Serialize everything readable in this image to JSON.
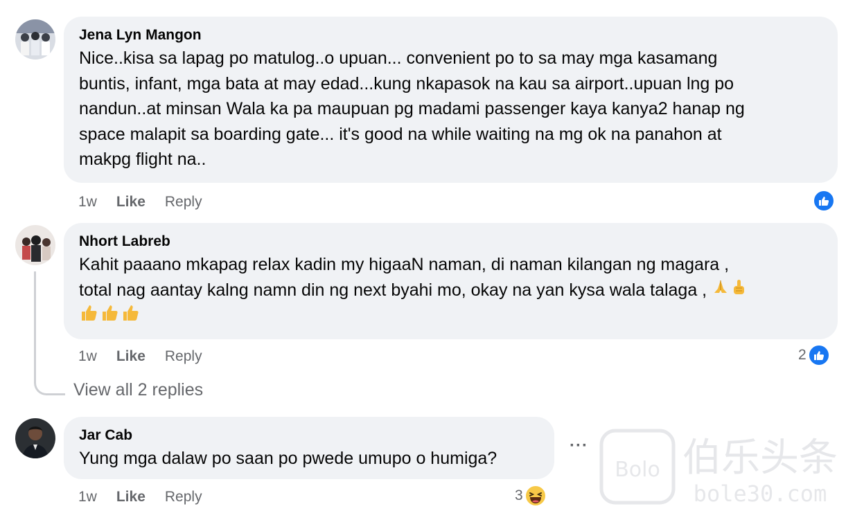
{
  "comments": [
    {
      "author": "Jena Lyn Mangon",
      "lines": [
        "Nice..kisa sa lapag po matulog..o upuan... convenient po to sa may mga kasamang",
        "buntis, infant, mga bata at may edad...kung nkapasok na kau sa airport..upuan lng po",
        "nandun..at minsan Wala ka pa maupuan pg madami passenger kaya kanya2 hanap ng",
        "space malapit sa boarding gate... it's good na while waiting na mg ok na panahon at",
        "makpg flight na.."
      ],
      "time": "1w",
      "like_label": "Like",
      "reply_label": "Reply",
      "reaction_count": ""
    },
    {
      "author": "Nhort Labreb",
      "lines": [
        "Kahit paaano mkapag relax kadin my higaaN naman, di naman kilangan ng magara ,",
        "total nag aantay kalng namn din ng next byahi mo, okay na yan kysa wala talaga ,"
      ],
      "time": "1w",
      "like_label": "Like",
      "reply_label": "Reply",
      "reaction_count": "2",
      "view_replies": "View all 2 replies"
    },
    {
      "author": "Jar Cab",
      "lines": [
        "Yung mga dalaw po saan po pwede umupo o humiga?"
      ],
      "time": "1w",
      "like_label": "Like",
      "reply_label": "Reply",
      "reaction_count": "3",
      "more_label": "···"
    }
  ],
  "icons": {
    "like_reaction": "like-thumb-icon",
    "haha_reaction": "laughing-emoji-icon",
    "praying_hands": "folded-hands-emoji",
    "hand_index": "index-pointing-up-emoji",
    "thumbs_up": "thumbs-up-emoji"
  },
  "watermark": {
    "text_top": "伯乐头条",
    "text_bottom": "bole30.com"
  },
  "colors": {
    "bubble": "#f0f2f5",
    "like_blue": "#1877f2",
    "meta_gray": "#65676b"
  }
}
